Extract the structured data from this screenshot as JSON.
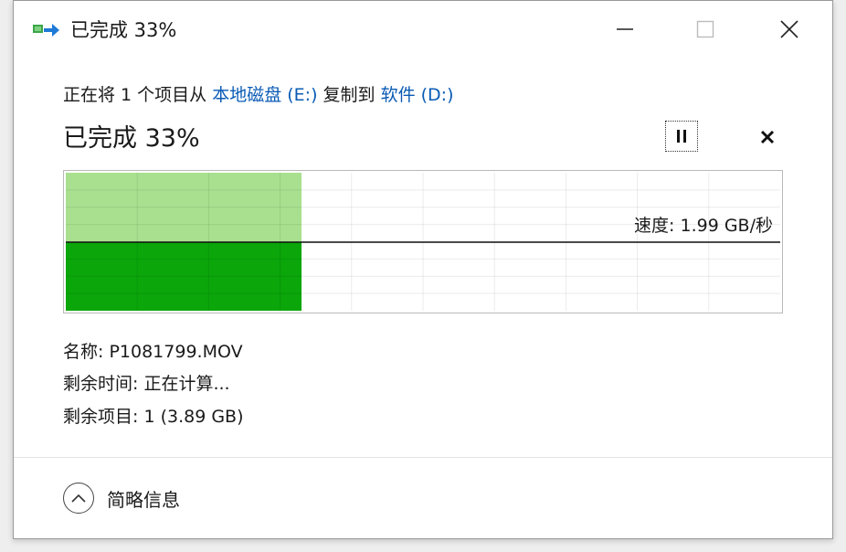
{
  "titlebar": {
    "title": "已完成 33%",
    "icon": "file-copy-icon",
    "minimize_icon": "minimize-icon",
    "maximize_icon": "maximize-icon",
    "close_icon": "close-icon"
  },
  "operation": {
    "prefix": "正在将 1 个项目从 ",
    "source": "本地磁盘 (E:)",
    "middle": " 复制到 ",
    "destination": "软件 (D:)",
    "link_color": "#0a5bb5"
  },
  "progress": {
    "title": "已完成 33%",
    "percent": 33,
    "speed_text": "速度: 1.99 GB/秒",
    "pause_icon": "pause-icon",
    "cancel_icon": "cancel-icon",
    "fill_light": "#a8e08f",
    "fill_dark": "#0aa60a"
  },
  "details": {
    "name_label": "名称:",
    "name_value": "P1081799.MOV",
    "time_label": "剩余时间:",
    "time_value": "正在计算...",
    "items_label": "剩余项目:",
    "items_value": "1 (3.89 GB)"
  },
  "footer": {
    "less_info_label": "简略信息",
    "less_info_icon": "chevron-up-icon"
  }
}
